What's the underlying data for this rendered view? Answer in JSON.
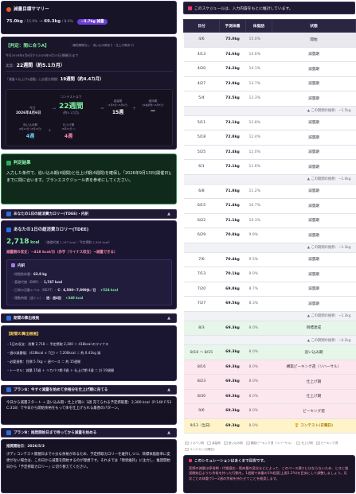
{
  "summary": {
    "title": "減量目標サマリー",
    "start_weight": "75.0kg",
    "start_pct": "/ 15.0%",
    "target_weight": "69.3kg",
    "target_pct": "/ 8.0%",
    "badge": "−5.7kg 減量"
  },
  "judgement": {
    "heading": "【判定：間に合うA】",
    "heading_sub": "（最短期間なし・追い込み期あり・仕上げ期あり）",
    "range_text": "今日2026年4月6日から2026年9月13日(開催日)まで",
    "weeks_label": "実質：",
    "weeks_value": "22週間（約5.1カ月）",
    "need_label": "「減量＋仕上げ4週間」に必要な期間：",
    "need_value": "19週間（約4.4カ月）"
  },
  "timeline": {
    "today_label": "今日",
    "today_date": "2026年4月6日",
    "contest_label": "コンテストまで",
    "contest_weeks": "22週間",
    "contest_sub": "(約5.1カ月)",
    "reduction_label": "減量期",
    "reduction_sub": "(4月6日〜8月9日)",
    "reduction_weeks": "15週",
    "rest_label": "維持期",
    "rest_sub": "(余裕調整〜6月5日)",
    "rest_weeks": "—",
    "push_label": "追い込み期",
    "push_sub": "(8月10日〜8月16日)",
    "push_weeks": "4週",
    "final_label": "仕上げ期",
    "final_sub": "(8月23日〜)",
    "final_weeks": "4週"
  },
  "result": {
    "heading": "判定結果",
    "text": "入力した条件で、追い込み期(4週間)と仕上げ期(4週間)を確保し「2026年9月13日(開催日)」までに間に合います。ブランエスケジュール表を参考にしてください。"
  },
  "tdee_section": {
    "header": "あなたの1日の総消費カロリー(TDEE)・内訳",
    "title": "あなたの1日の総消費カロリー(TDEE)",
    "value": "2,718",
    "unit": "kcal",
    "detail": "（基礎代謝 1,747 kcal ／予定摂取 2,300 kcal）",
    "deficit": "減量期の収支：−418 kcal/日（赤字（マイナス収支）→減量できる）",
    "breakdown_title": "内訳",
    "rows": [
      {
        "label": "・除脂肪体重：",
        "value": "63.8 kg",
        "extra": ""
      },
      {
        "label": "・基礎代謝（BMR）：",
        "value": "1,747 kcal",
        "extra": ""
      },
      {
        "label": "・日常の活動レベル（NEAT）：",
        "value": "C：6,500〜7,999歩／日",
        "extra": "+524 kcal"
      },
      {
        "label": "・運動時間（週トレ）：",
        "value": "週：週4回",
        "extra": "+349 kcal"
      }
    ]
  },
  "calc_section": {
    "header": "期間の算出根拠",
    "title": "【期間の算出根拠】",
    "lines": [
      "・1日の収支：消費 2,718 − 予定摂取 2,300 ＝ 418kcal のマイナス",
      "・週の減量幅：(418kcal × 7日) ÷ 7,200kcal ＝ 約 0.41kg 減",
      "・必要週数：目標 5.7kg ÷ 週ペース ＝ 約 15週間",
      "・トータル：減量 15週 ＋ リカバリ期 0週 ＋ 仕上げ期 4週 ＝ 計 19週間"
    ]
  },
  "planA": {
    "header": "プランA：今すぐ減量を始めて余裕分を仕上げ期に充てる",
    "text": "今日から減量スタート → 追い込み期・仕上げ期に 3週 充てられる予定摂取量：2,300 kcal（P:140 F:53 C:318）で今日から開始余裕をもって体を仕上げられる最善のパターン。"
  },
  "planB": {
    "header": "プランB：推奨開始日まで待ってから減量を始める",
    "date_label": "推奨開始日：2026/5/3",
    "text": "ボディコンテスト開催日まで十分な余裕があるため、予定摂取カロリーを維持しつつ、目標体脂肪率に変更がない場合は、この日から減量を開始するのが理想です。それまでは「現状維持」に注力し、推奨開始日から「予定摂取カロリー」に切り替えてください。"
  },
  "notice": "このスケジュールは、入力内容をもとに推計しています。",
  "table": {
    "headers": [
      "日付",
      "予測体重",
      "体脂肪",
      "状態"
    ],
    "rows": [
      {
        "type": "shade",
        "date": "4/6",
        "weight": "75.0kg",
        "fat": "15.0%",
        "status": "開始"
      },
      {
        "type": "",
        "date": "4/13",
        "weight": "74.6kg",
        "fat": "14.6%",
        "status": "減量期"
      },
      {
        "type": "",
        "date": "4/20",
        "weight": "74.2kg",
        "fat": "14.1%",
        "status": "減量期"
      },
      {
        "type": "",
        "date": "4/27",
        "weight": "73.9kg",
        "fat": "13.7%",
        "status": "減量期"
      },
      {
        "type": "",
        "date": "5/4",
        "weight": "73.5kg",
        "fat": "13.3%",
        "status": "減量期"
      },
      {
        "type": "sum",
        "text": "▲ この期間の推移：−1.5kg"
      },
      {
        "type": "",
        "date": "5/11",
        "weight": "73.1kg",
        "fat": "12.8%",
        "status": "減量期"
      },
      {
        "type": "",
        "date": "5/18",
        "weight": "72.8kg",
        "fat": "12.4%",
        "status": "減量期"
      },
      {
        "type": "",
        "date": "5/25",
        "weight": "72.4kg",
        "fat": "12.0%",
        "status": "減量期"
      },
      {
        "type": "",
        "date": "6/1",
        "weight": "72.1kg",
        "fat": "11.6%",
        "status": "減量期"
      },
      {
        "type": "sum",
        "text": "▲ この期間の推移：−1.4kg"
      },
      {
        "type": "",
        "date": "6/8",
        "weight": "71.8kg",
        "fat": "11.2%",
        "status": "減量期"
      },
      {
        "type": "",
        "date": "6/15",
        "weight": "71.4kg",
        "fat": "10.7%",
        "status": "減量期"
      },
      {
        "type": "",
        "date": "6/22",
        "weight": "71.1kg",
        "fat": "10.3%",
        "status": "減量期"
      },
      {
        "type": "",
        "date": "6/29",
        "weight": "70.8kg",
        "fat": "9.9%",
        "status": "減量期"
      },
      {
        "type": "sum",
        "text": "▲ この期間の推移：−1.3kg"
      },
      {
        "type": "",
        "date": "7/6",
        "weight": "70.4kg",
        "fat": "9.5%",
        "status": "減量期"
      },
      {
        "type": "",
        "date": "7/13",
        "weight": "70.1kg",
        "fat": "9.0%",
        "status": "減量期"
      },
      {
        "type": "",
        "date": "7/20",
        "weight": "69.8kg",
        "fat": "8.7%",
        "status": "減量期"
      },
      {
        "type": "",
        "date": "7/27",
        "weight": "69.5kg",
        "fat": "8.3%",
        "status": "減量期"
      },
      {
        "type": "sum",
        "text": "▲ この期間の推移：−1.3kg"
      },
      {
        "type": "reach",
        "date": "8/3",
        "weight": "69.3kg",
        "fat": "8.0%",
        "status": "目標達成"
      },
      {
        "type": "sum",
        "text": "▲ この期間の推移：−0.2kg"
      },
      {
        "type": "reach",
        "date": "8/10 〜 8/15",
        "weight": "69.3kg",
        "fat": "8.0%",
        "status": "追い込み期"
      },
      {
        "type": "pinkrow",
        "date": "8/16",
        "weight": "69.3kg",
        "fat": "8.0%",
        "status": "構築ピーキング週（リハーサル）"
      },
      {
        "type": "pinkrow",
        "date": "8/23",
        "weight": "69.3kg",
        "fat": "8.0%",
        "status": "仕上げ期"
      },
      {
        "type": "pinkrow",
        "date": "8/30",
        "weight": "69.3kg",
        "fat": "8.0%",
        "status": "仕上げ期"
      },
      {
        "type": "pinkrow",
        "date": "9/6",
        "weight": "69.3kg",
        "fat": "8.0%",
        "status": "ピーキング週"
      },
      {
        "type": "goal",
        "date": "9/13（当日）",
        "weight": "69.3kg",
        "fat": "8.0%",
        "status": "🏆 コンテスト(日曜日)"
      }
    ]
  },
  "legend": [
    "リカバリ期",
    "減量期",
    "追い込み期",
    "模擬ピーキング週（リハーサル）",
    "仕上げ期",
    "ピーキング週",
    "コンテスト(日曜日)"
  ],
  "bottom_note": {
    "title": "このシミュレーションはあくまで目安です。",
    "text": "実際の減量は停滞期・代謝適応・筋肉量の変化などによって、このペース通りにはならないため、ときに推奨開始日よりも余裕を持った行動を。1週間で体重の1%程度(上限1.2%)を目安にして調整しましょう。月次ごとの体重で1〜2週の余裕を持たせてことを推奨します。"
  }
}
